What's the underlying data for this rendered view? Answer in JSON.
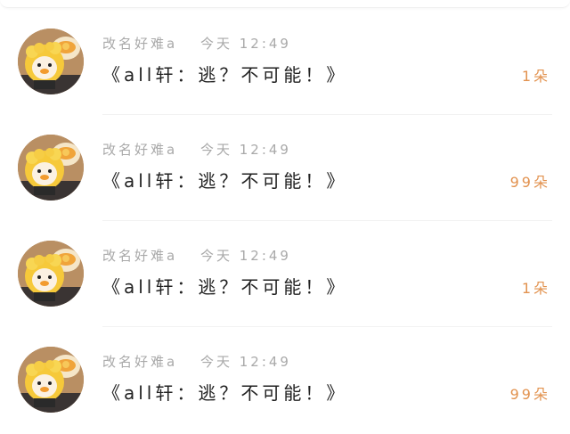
{
  "colors": {
    "accent": "#e2924f",
    "meta_text": "#a9a9a9",
    "title_text": "#222222"
  },
  "items": [
    {
      "author": "改名好难a",
      "time": "今天 12:49",
      "title": "《all轩：逃？不可能！》",
      "count": "1朵",
      "avatar_icon": "duck-avatar-image"
    },
    {
      "author": "改名好难a",
      "time": "今天 12:49",
      "title": "《all轩：逃？不可能！》",
      "count": "99朵",
      "avatar_icon": "duck-avatar-image"
    },
    {
      "author": "改名好难a",
      "time": "今天 12:49",
      "title": "《all轩：逃？不可能！》",
      "count": "1朵",
      "avatar_icon": "duck-avatar-image"
    },
    {
      "author": "改名好难a",
      "time": "今天 12:49",
      "title": "《all轩：逃？不可能！》",
      "count": "99朵",
      "avatar_icon": "duck-avatar-image"
    }
  ]
}
